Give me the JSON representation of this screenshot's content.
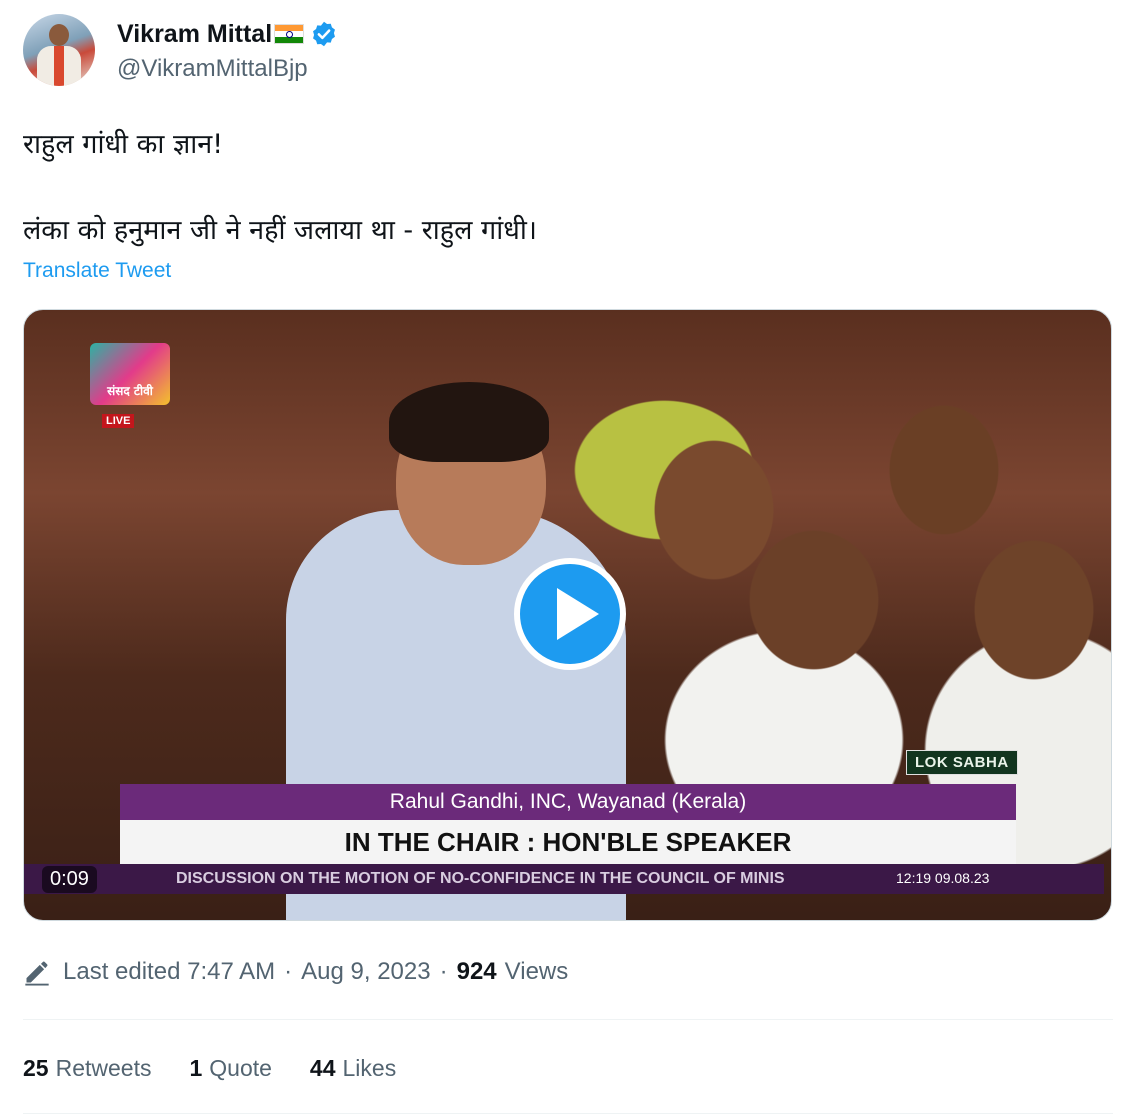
{
  "author": {
    "display_name": "Vikram Mittal",
    "handle": "@VikramMittalBjp",
    "avatar_icon": "profile-photo",
    "flag_icon": "india-flag-emoji",
    "verified_icon": "verified-badge-icon"
  },
  "tweet": {
    "line1": "राहुल गांधी का ज्ञान!",
    "line2": "लंका को हनुमान जी ने नहीं जलाया था - राहुल गांधी।",
    "translate_label": "Translate Tweet"
  },
  "video": {
    "channel_logo_text": "संसद टीवी",
    "live_label": "LIVE",
    "location_tag": "LOK SABHA",
    "lower_third_top": "Rahul Gandhi, INC, Wayanad (Kerala)",
    "lower_third_main": "IN THE CHAIR : HON'BLE SPEAKER",
    "ticker": "DISCUSSION ON THE MOTION OF NO-CONFIDENCE IN THE COUNCIL OF MINIS",
    "ticker_timestamp": "12:19 09.08.23",
    "duration": "0:09",
    "play_icon": "play-icon"
  },
  "meta": {
    "edited_label": "Last edited 7:47 AM",
    "date": "Aug 9, 2023",
    "separator": "·",
    "views_count": "924",
    "views_label": "Views"
  },
  "stats": {
    "retweets_count": "25",
    "retweets_label": "Retweets",
    "quotes_count": "1",
    "quotes_label": "Quote",
    "likes_count": "44",
    "likes_label": "Likes"
  },
  "colors": {
    "accent": "#1d9bf0",
    "text_primary": "#0f1419",
    "text_secondary": "#536471",
    "lower_third_purple": "#6b2a7a"
  }
}
